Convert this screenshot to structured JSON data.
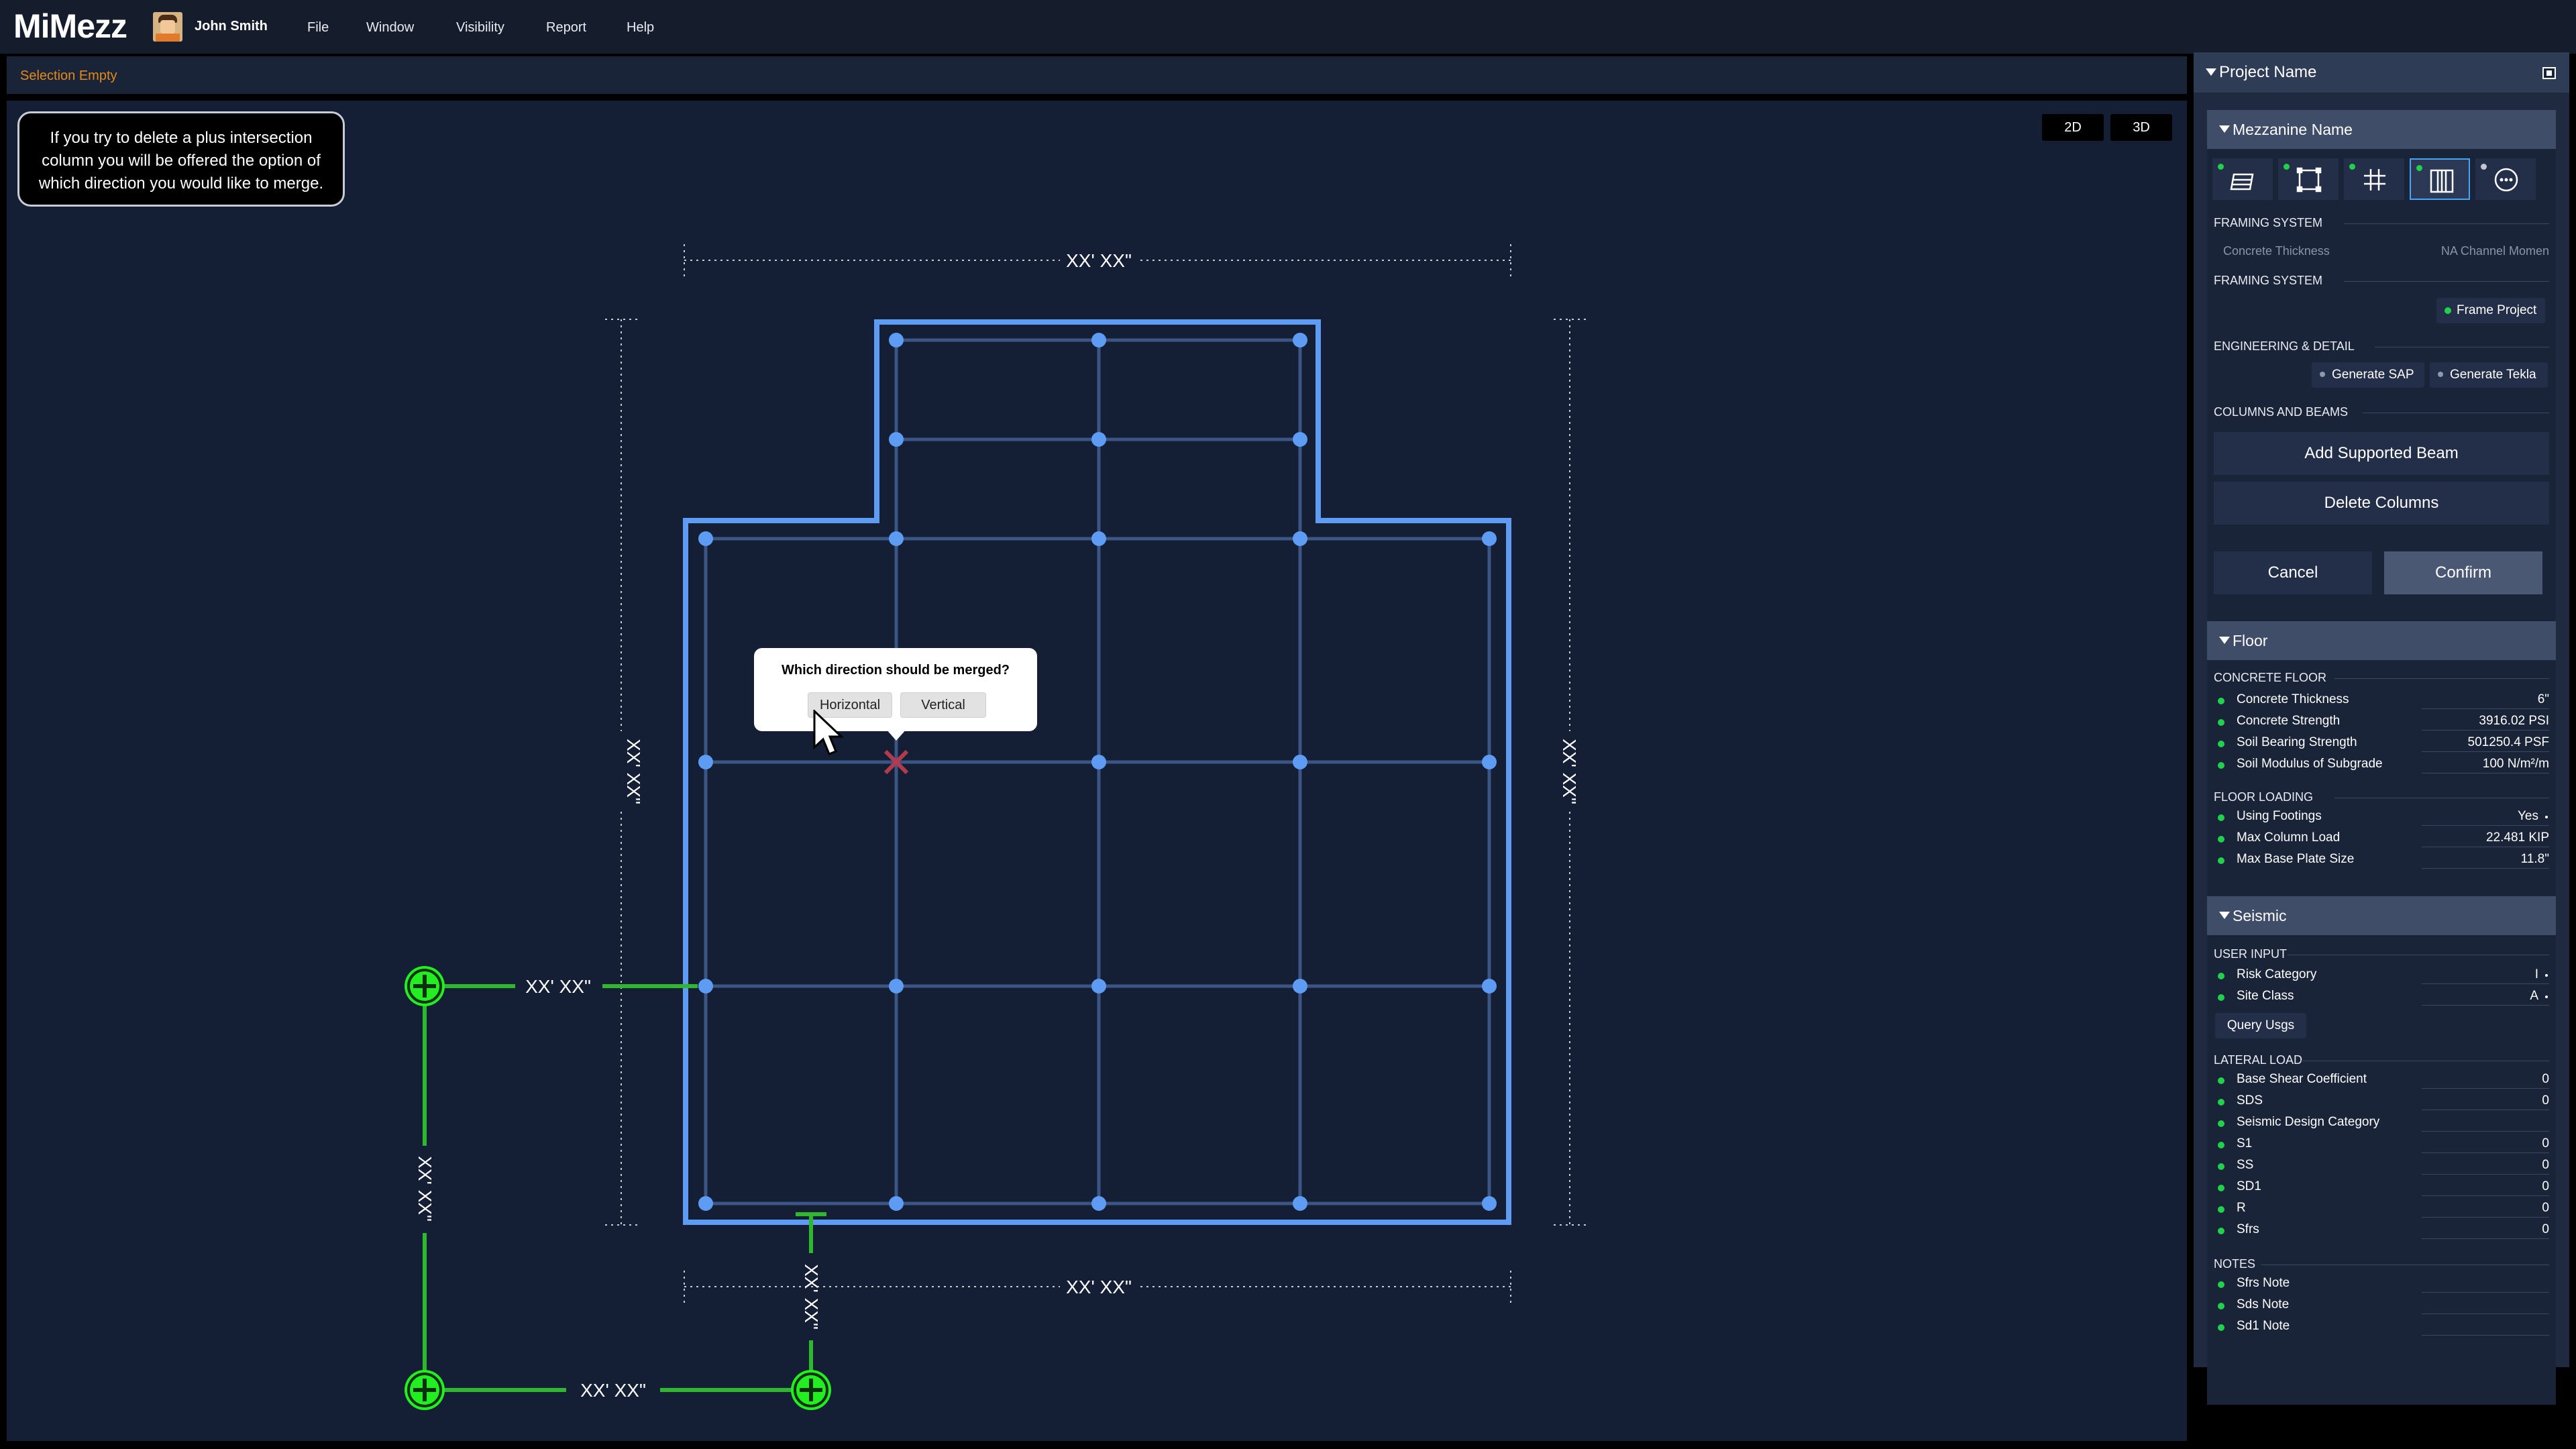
{
  "app": {
    "logo": "MiMezz",
    "user_name": "John Smith",
    "menu": [
      "File",
      "Window",
      "Visibility",
      "Report",
      "Help"
    ]
  },
  "status": {
    "selection": "Selection Empty"
  },
  "canvas": {
    "tooltip": "If you try to delete a plus intersection column you will be offered the option of which direction you would like to merge.",
    "view_2d": "2D",
    "view_3d": "3D",
    "dims": {
      "top": "XX' XX\"",
      "bottom": "XX' XX\"",
      "left": "XX' XX\"",
      "right": "XX' XX\"",
      "green_h_top": "XX' XX\"",
      "green_v_left": "XX' XX\"",
      "green_h_bottom": "XX' XX\"",
      "green_v_mid": "XX' XX\""
    },
    "merge_popup": {
      "title": "Which direction should be merged?",
      "horizontal": "Horizontal",
      "vertical": "Vertical"
    }
  },
  "panel": {
    "project_title": "Project Name",
    "mezzanine_title": "Mezzanine Name",
    "toolbar_icons": [
      "floor-stack-icon",
      "square-frame-icon",
      "grid-icon",
      "columns-icon",
      "more-icon"
    ],
    "framing1_label": "FRAMING SYSTEM",
    "framing1_left": "Concrete Thickness",
    "framing1_right": "NA Channel Momen",
    "framing2_label": "FRAMING SYSTEM",
    "frame_project": "Frame Project",
    "eng_label": "ENGINEERING & DETAIL",
    "generate_sap": "Generate SAP",
    "generate_tekla": "Generate Tekla",
    "cols_beams_label": "COLUMNS AND BEAMS",
    "add_beam": "Add Supported Beam",
    "delete_columns": "Delete Columns",
    "cancel": "Cancel",
    "confirm": "Confirm",
    "floor": {
      "title": "Floor",
      "concrete_label": "CONCRETE FLOOR",
      "concrete_rows": [
        {
          "label": "Concrete Thickness",
          "value": "6\""
        },
        {
          "label": "Concrete Strength",
          "value": "3916.02 PSI"
        },
        {
          "label": "Soil Bearing Strength",
          "value": "501250.4 PSF"
        },
        {
          "label": "Soil Modulus of Subgrade",
          "value": "100 N/m²/m"
        }
      ],
      "loading_label": "FLOOR LOADING",
      "loading_rows": [
        {
          "label": "Using Footings",
          "value": "Yes"
        },
        {
          "label": "Max Column Load",
          "value": "22.481 KIP"
        },
        {
          "label": "Max Base Plate Size",
          "value": "11.8\""
        }
      ]
    },
    "seismic": {
      "title": "Seismic",
      "user_input_label": "USER INPUT",
      "user_rows": [
        {
          "label": "Risk Category",
          "value": "I"
        },
        {
          "label": "Site Class",
          "value": "A"
        }
      ],
      "query_usgs": "Query Usgs",
      "lateral_label": "LATERAL LOAD",
      "lateral_rows": [
        {
          "label": "Base Shear Coefficient",
          "value": "0"
        },
        {
          "label": "SDS",
          "value": "0"
        },
        {
          "label": "Seismic Design Category",
          "value": ""
        },
        {
          "label": "S1",
          "value": "0"
        },
        {
          "label": "SS",
          "value": "0"
        },
        {
          "label": "SD1",
          "value": "0"
        },
        {
          "label": "R",
          "value": "0"
        },
        {
          "label": "Sfrs",
          "value": "0"
        }
      ],
      "notes_label": "NOTES",
      "notes_rows": [
        {
          "label": "Sfrs Note"
        },
        {
          "label": "Sds Note"
        },
        {
          "label": "Sd1 Note"
        }
      ]
    }
  }
}
